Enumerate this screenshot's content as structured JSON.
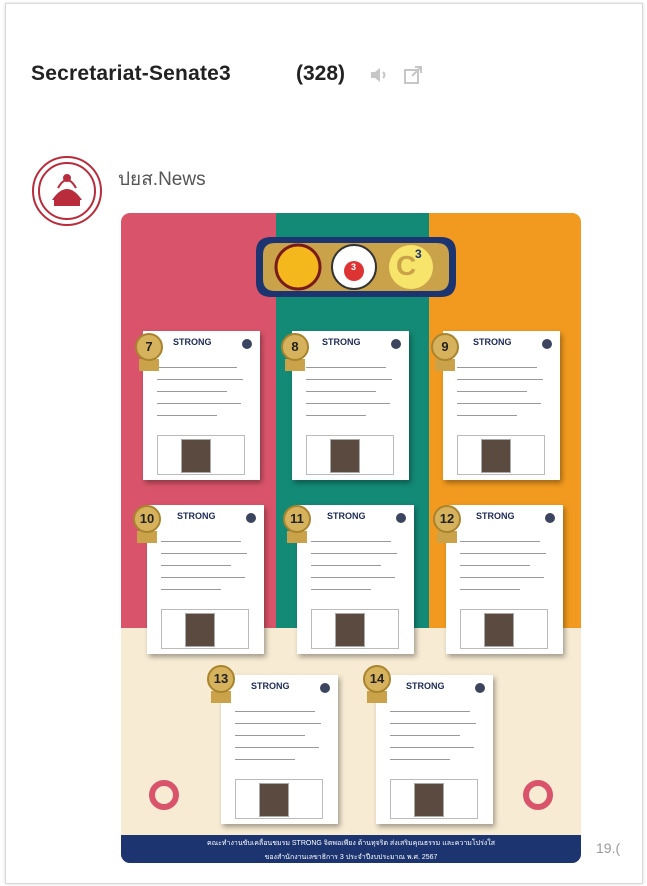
{
  "header": {
    "title": "Secretariat-Senate3",
    "count": "(328)"
  },
  "message": {
    "sender": "ปยส.News",
    "time": "19.("
  },
  "post": {
    "medals": [
      "7",
      "8",
      "9",
      "10",
      "11",
      "12",
      "13",
      "14"
    ],
    "card_logo": "STRONG",
    "footer_line1": "คณะทำงานขับเคลื่อนชมรม STRONG จิตพอเพียง ต้านทุจริต ส่งเสริมคุณธรรม และความโปร่งใส",
    "footer_line2": "ของสำนักงานเลขาธิการ 3 ประจำปีงบประมาณ พ.ศ. 2567",
    "badge_c": "C",
    "badge_c_sup": "3",
    "badge_center_num": "3"
  },
  "colors": {
    "pink": "#d9546a",
    "green": "#138a76",
    "orange": "#f29a1f",
    "cream": "#f7ebd3",
    "navy": "#1c3470"
  }
}
